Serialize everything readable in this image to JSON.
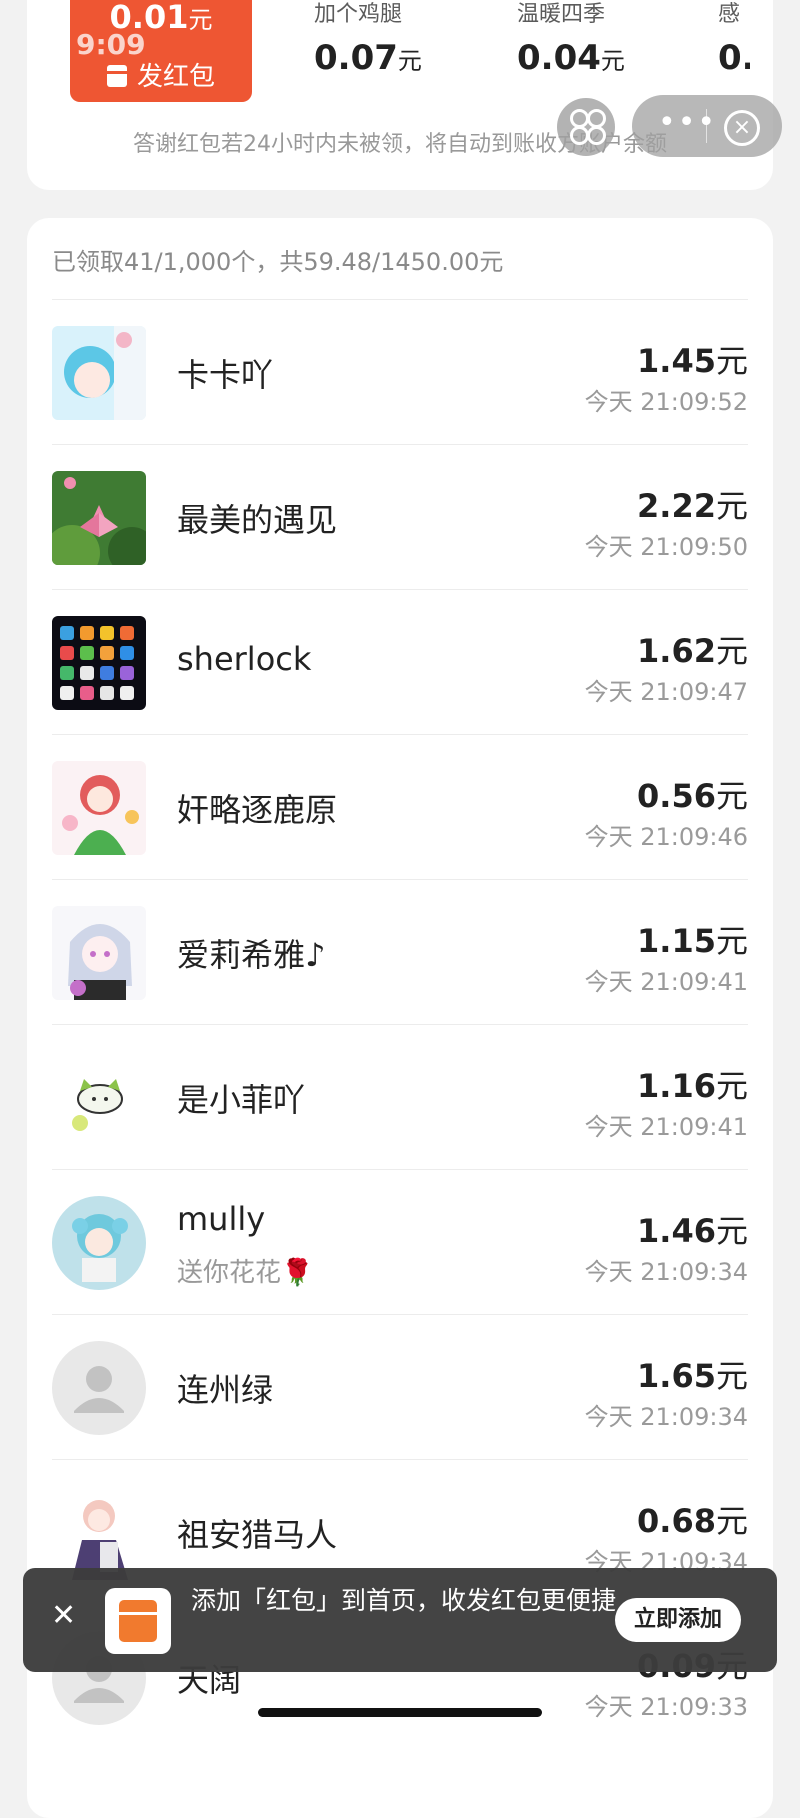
{
  "top": {
    "amount": "0.01",
    "amount_unit": "元",
    "faded_time": "9:09",
    "send_label": "发红包",
    "options": [
      {
        "name": "加个鸡腿",
        "value": "0.07",
        "unit": "元"
      },
      {
        "name": "温暖四季",
        "value": "0.04",
        "unit": "元"
      },
      {
        "name": "感",
        "value": "0.",
        "unit": ""
      }
    ],
    "notice": "答谢红包若24小时内未被领，将自动到账收方账户余额"
  },
  "summary": "已领取41/1,000个，共59.48/1450.00元",
  "records": [
    {
      "name": "卡卡吖",
      "note": "",
      "amount": "1.45",
      "unit": "元",
      "time": "今天 21:09:52"
    },
    {
      "name": "最美的遇见",
      "note": "",
      "amount": "2.22",
      "unit": "元",
      "time": "今天 21:09:50"
    },
    {
      "name": "sherlock",
      "note": "",
      "amount": "1.62",
      "unit": "元",
      "time": "今天 21:09:47"
    },
    {
      "name": "奸略逐鹿原",
      "note": "",
      "amount": "0.56",
      "unit": "元",
      "time": "今天 21:09:46"
    },
    {
      "name": "爱莉希雅♪",
      "note": "",
      "amount": "1.15",
      "unit": "元",
      "time": "今天 21:09:41"
    },
    {
      "name": "是小菲吖",
      "note": "",
      "amount": "1.16",
      "unit": "元",
      "time": "今天 21:09:41"
    },
    {
      "name": "mully",
      "note": "送你花花🌹",
      "amount": "1.46",
      "unit": "元",
      "time": "今天 21:09:34"
    },
    {
      "name": "连州绿",
      "note": "",
      "amount": "1.65",
      "unit": "元",
      "time": "今天 21:09:34"
    },
    {
      "name": "祖安猎马人",
      "note": "",
      "amount": "0.68",
      "unit": "元",
      "time": "今天 21:09:34"
    },
    {
      "name": "天阔",
      "note": "",
      "amount": "0.09",
      "unit": "元",
      "time": "今天 21:09:33"
    }
  ],
  "toast": {
    "text": "添加「红包」到首页，收发红包更便捷",
    "button": "立即添加"
  }
}
